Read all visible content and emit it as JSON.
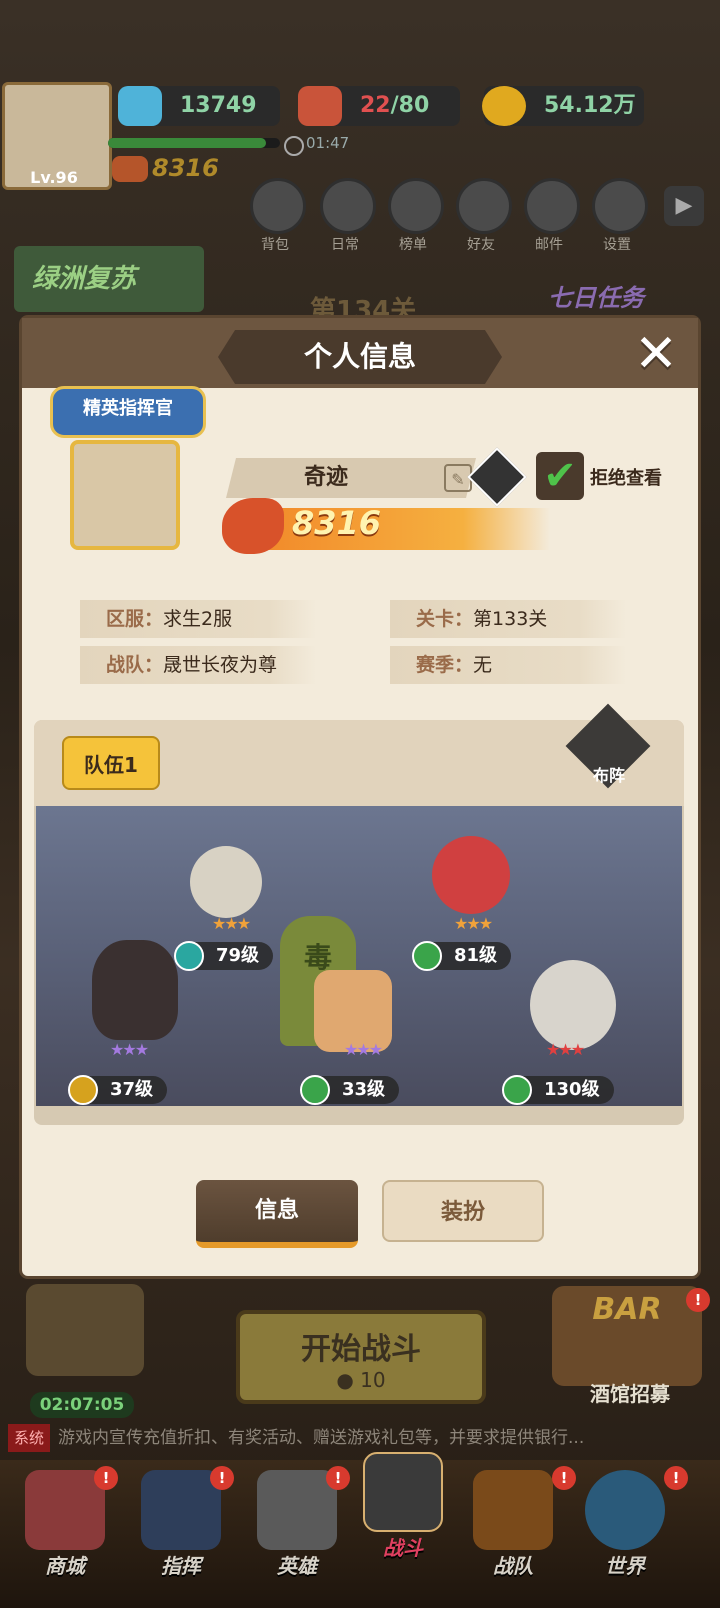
{
  "top_bar": {
    "level": "Lv.96",
    "diamond": "13749",
    "stamina_current": "22",
    "stamina_max": "/80",
    "gold": "54.12万",
    "timer": "01:47",
    "power": "8316"
  },
  "top_menu": [
    {
      "label": "背包"
    },
    {
      "label": "日常"
    },
    {
      "label": "榜单"
    },
    {
      "label": "好友"
    },
    {
      "label": "邮件"
    },
    {
      "label": "设置"
    }
  ],
  "event_banner": "绿洲复苏",
  "stage_banner": "第134关",
  "seven_day_task": "七日任务",
  "modal": {
    "title": "个人信息",
    "rank_title": "精英指挥官",
    "player_name": "奇迹",
    "power": "8316",
    "reject_view_label": "拒绝查看",
    "server_key": "区服：",
    "server_value": "求生2服",
    "stage_key": "关卡：",
    "stage_value": "第133关",
    "team_key": "战队：",
    "team_value": "晟世长夜为尊",
    "season_key": "赛季：",
    "season_value": "无",
    "team_tab": "队伍1",
    "formation_label": "布阵",
    "heroes": [
      {
        "level": "79级",
        "stars": "★★★",
        "color": "#2aa7a0"
      },
      {
        "level": "81级",
        "stars": "★★★",
        "color": "#3aa44a"
      },
      {
        "level": "37级",
        "stars": "★★★",
        "color": "#d6a21e"
      },
      {
        "level": "33级",
        "stars": "★★★",
        "color": "#3aa44a"
      },
      {
        "level": "130级",
        "stars": "★★★",
        "color": "#3aa44a"
      }
    ],
    "poison_text": "毒",
    "info_button": "信息",
    "outfit_button": "装扮"
  },
  "bottom": {
    "timer": "02:07:05",
    "start_battle": "开始战斗",
    "cost": "10",
    "tavern": "酒馆招募",
    "bar_sign": "BAR",
    "system_tag": "系统",
    "system_message": "游戏内宣传充值折扣、有奖活动、赠送游戏礼包等，并要求提供银行...",
    "nav": [
      {
        "label": "商城"
      },
      {
        "label": "指挥"
      },
      {
        "label": "英雄"
      },
      {
        "label": "战斗"
      },
      {
        "label": "战队"
      },
      {
        "label": "世界"
      }
    ]
  }
}
